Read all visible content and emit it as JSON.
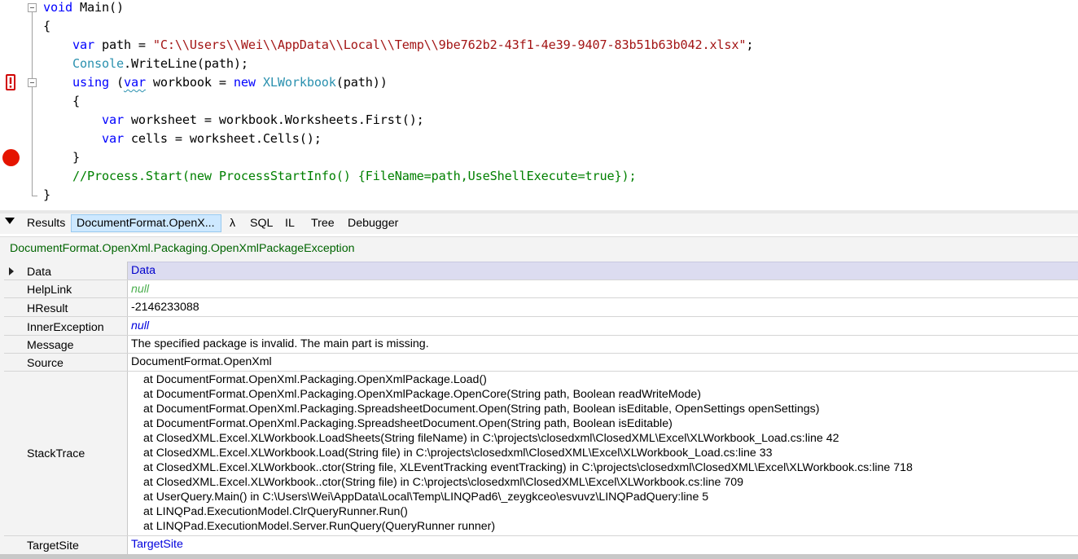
{
  "editor": {
    "lines": [
      {
        "parts": [
          {
            "c": "kw",
            "t": "void"
          },
          {
            "c": "",
            "t": " Main()"
          }
        ]
      },
      {
        "parts": [
          {
            "c": "",
            "t": "{"
          }
        ]
      },
      {
        "parts": [
          {
            "c": "",
            "t": "    "
          },
          {
            "c": "kw",
            "t": "var"
          },
          {
            "c": "",
            "t": " path = "
          },
          {
            "c": "str",
            "t": "\"C:\\\\Users\\\\Wei\\\\AppData\\\\Local\\\\Temp\\\\9be762b2-43f1-4e39-9407-83b51b63b042.xlsx\""
          },
          {
            "c": "",
            "t": ";"
          }
        ]
      },
      {
        "parts": [
          {
            "c": "",
            "t": "    "
          },
          {
            "c": "typ",
            "t": "Console"
          },
          {
            "c": "",
            "t": ".WriteLine(path);"
          }
        ]
      },
      {
        "parts": [
          {
            "c": "",
            "t": "    "
          },
          {
            "c": "kw",
            "t": "using"
          },
          {
            "c": "",
            "t": " ("
          },
          {
            "c": "kw squig",
            "t": "var"
          },
          {
            "c": "",
            "t": " workbook = "
          },
          {
            "c": "kw",
            "t": "new"
          },
          {
            "c": "",
            "t": " "
          },
          {
            "c": "typ",
            "t": "XLWorkbook"
          },
          {
            "c": "",
            "t": "(path))"
          }
        ]
      },
      {
        "parts": [
          {
            "c": "",
            "t": "    {"
          }
        ]
      },
      {
        "parts": [
          {
            "c": "",
            "t": "        "
          },
          {
            "c": "kw",
            "t": "var"
          },
          {
            "c": "",
            "t": " worksheet = workbook.Worksheets.First();"
          }
        ]
      },
      {
        "parts": [
          {
            "c": "",
            "t": "        "
          },
          {
            "c": "kw",
            "t": "var"
          },
          {
            "c": "",
            "t": " cells = worksheet.Cells();"
          }
        ]
      },
      {
        "parts": [
          {
            "c": "",
            "t": "    }"
          }
        ]
      },
      {
        "parts": [
          {
            "c": "",
            "t": "    "
          },
          {
            "c": "cmt",
            "t": "//Process.Start(new ProcessStartInfo() {FileName=path,UseShellExecute=true});"
          }
        ]
      },
      {
        "parts": [
          {
            "c": "",
            "t": "}"
          }
        ]
      }
    ]
  },
  "tabs": {
    "results": "Results",
    "active": "DocumentFormat.OpenX...",
    "lambda": "λ",
    "sql": "SQL",
    "il": "IL",
    "tree": "Tree",
    "debugger": "Debugger"
  },
  "exception": {
    "type": "DocumentFormat.OpenXml.Packaging.OpenXmlPackageException",
    "rows": {
      "data_label": "Data",
      "data_value": "Data",
      "helplink_label": "HelpLink",
      "helplink_value": "null",
      "hresult_label": "HResult",
      "hresult_value": "-2146233088",
      "inner_label": "InnerException",
      "inner_value": "null",
      "message_label": "Message",
      "message_value": "The specified package is invalid. The main part is missing.",
      "source_label": "Source",
      "source_value": "DocumentFormat.OpenXml",
      "stacktrace_label": "StackTrace",
      "targetsite_label": "TargetSite",
      "targetsite_value": "TargetSite"
    },
    "stacktrace": [
      "at DocumentFormat.OpenXml.Packaging.OpenXmlPackage.Load()",
      "at DocumentFormat.OpenXml.Packaging.OpenXmlPackage.OpenCore(String path, Boolean readWriteMode)",
      "at DocumentFormat.OpenXml.Packaging.SpreadsheetDocument.Open(String path, Boolean isEditable, OpenSettings openSettings)",
      "at DocumentFormat.OpenXml.Packaging.SpreadsheetDocument.Open(String path, Boolean isEditable)",
      "at ClosedXML.Excel.XLWorkbook.LoadSheets(String fileName) in C:\\projects\\closedxml\\ClosedXML\\Excel\\XLWorkbook_Load.cs:line 42",
      "at ClosedXML.Excel.XLWorkbook.Load(String file) in C:\\projects\\closedxml\\ClosedXML\\Excel\\XLWorkbook_Load.cs:line 33",
      "at ClosedXML.Excel.XLWorkbook..ctor(String file, XLEventTracking eventTracking) in C:\\projects\\closedxml\\ClosedXML\\Excel\\XLWorkbook.cs:line 718",
      "at ClosedXML.Excel.XLWorkbook..ctor(String file) in C:\\projects\\closedxml\\ClosedXML\\Excel\\XLWorkbook.cs:line 709",
      "at UserQuery.Main() in C:\\Users\\Wei\\AppData\\Local\\Temp\\LINQPad6\\_zeygkceo\\esvuvz\\LINQPadQuery:line 5",
      "at LINQPad.ExecutionModel.ClrQueryRunner.Run()",
      "at LINQPad.ExecutionModel.Server.RunQuery(QueryRunner runner)"
    ]
  },
  "colors": {
    "keyword": "#0000ff",
    "string": "#a31515",
    "type": "#2b91af",
    "comment": "#008000",
    "breakpoint": "#e51400",
    "exception_type": "#006400"
  }
}
